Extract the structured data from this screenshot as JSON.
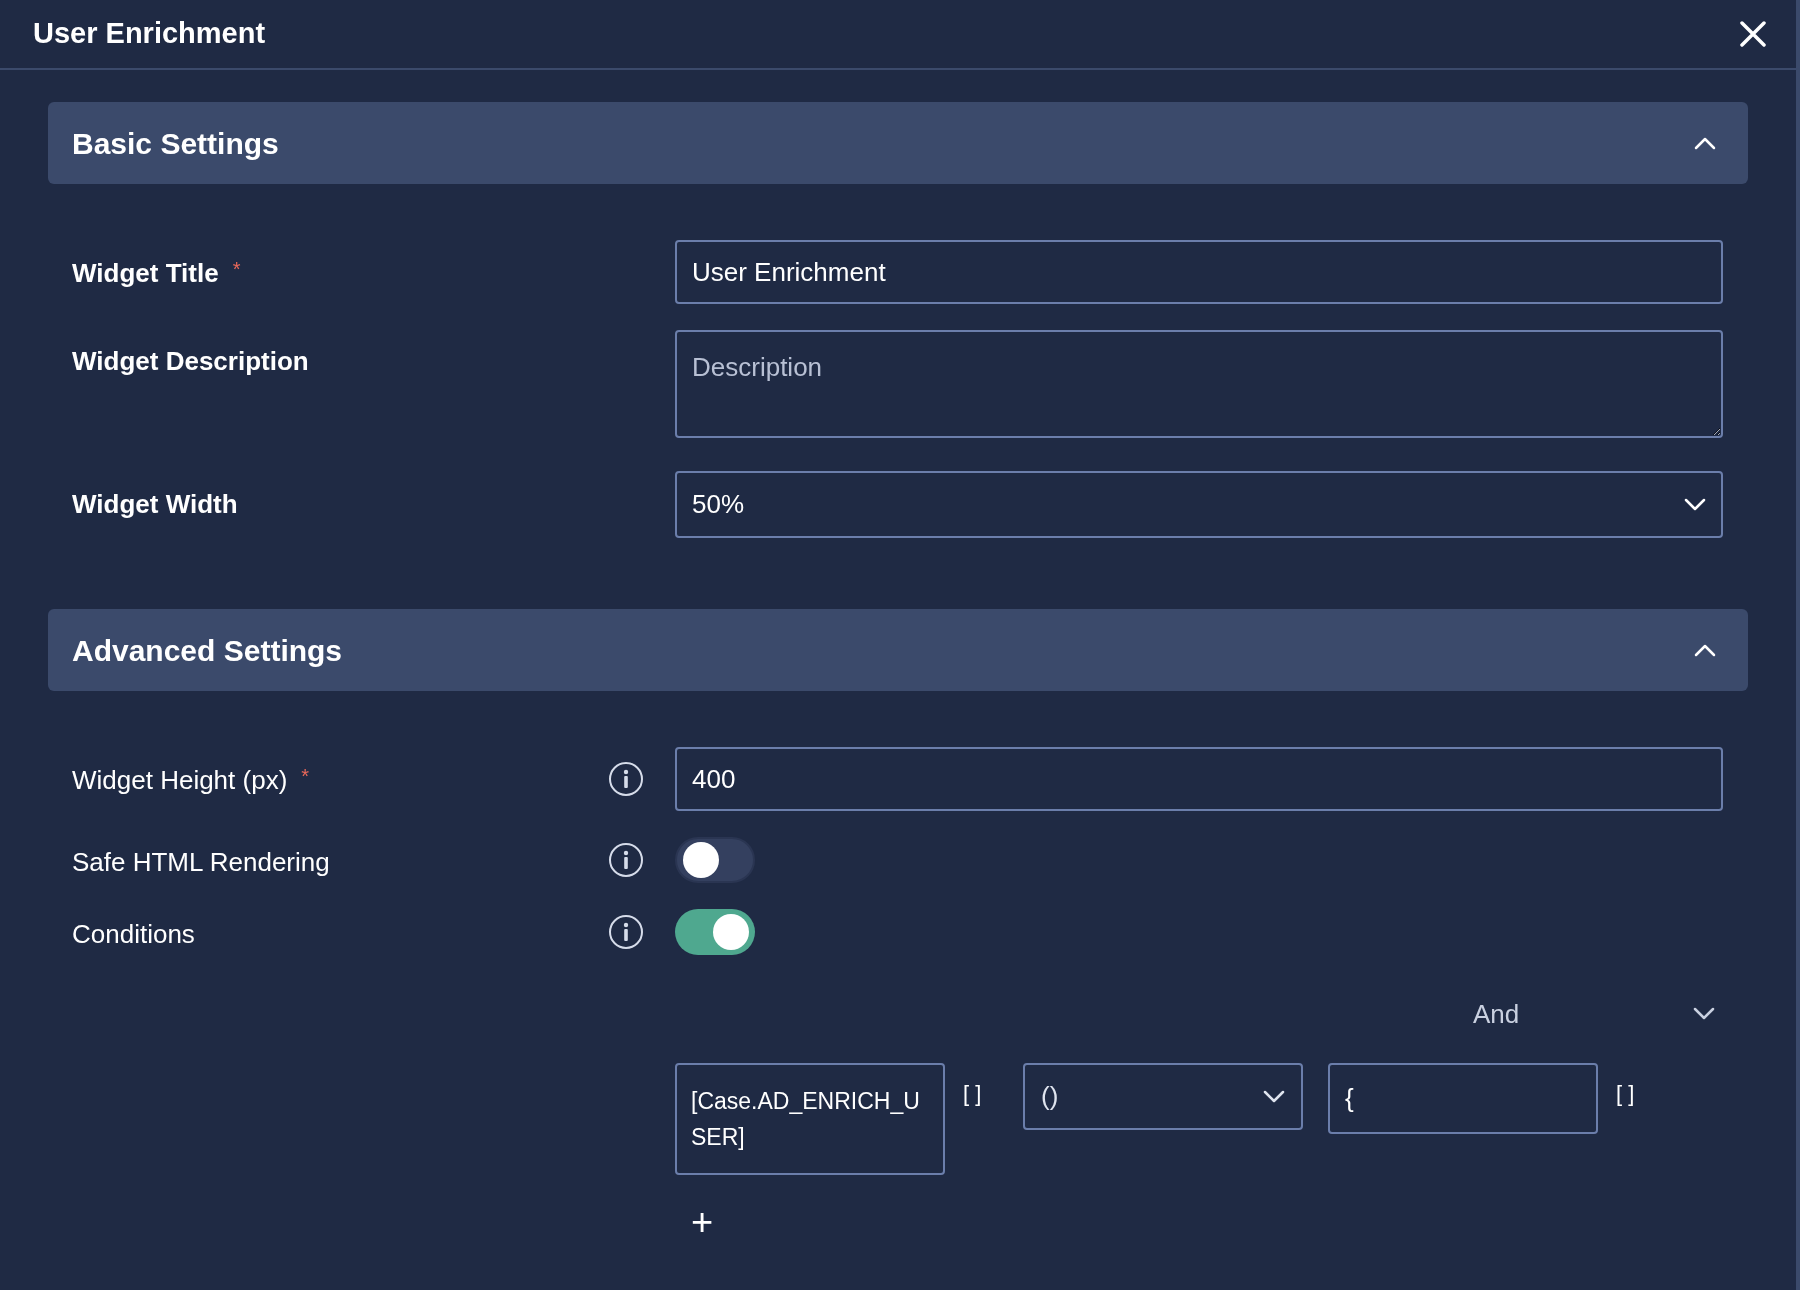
{
  "window": {
    "title": "User Enrichment"
  },
  "sections": [
    {
      "title": "Basic Settings",
      "expanded": true,
      "fields": [
        {
          "kind": "text",
          "label": "Widget Title",
          "required_mark": "*",
          "info": false,
          "value": "User Enrichment"
        },
        {
          "kind": "textarea",
          "label": "Widget Description",
          "info": false,
          "placeholder": "Description"
        },
        {
          "kind": "select",
          "label": "Widget Width",
          "info": false,
          "value": "50%"
        }
      ]
    },
    {
      "title": "Advanced Settings",
      "expanded": true,
      "fields": [
        {
          "kind": "text",
          "label": "Widget Height (px)",
          "required_mark": "*",
          "info": true,
          "value": "400"
        },
        {
          "kind": "toggle",
          "label": "Safe HTML Rendering",
          "info": true,
          "on": false
        },
        {
          "kind": "toggle",
          "label": "Conditions",
          "info": true,
          "on": true
        }
      ]
    }
  ],
  "conditions": {
    "operator": "And",
    "rows": [
      {
        "field": "[Case.AD_ENRICH_USER]",
        "field_brackets": "[ ]",
        "comparison": "()",
        "value": "{",
        "value_brackets": "[ ]"
      }
    ],
    "add": "+"
  }
}
